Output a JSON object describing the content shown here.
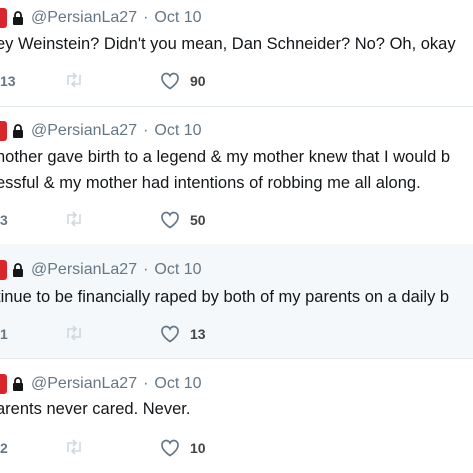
{
  "tweets": [
    {
      "handle": "@PersianLa27",
      "sep": "·",
      "date": "Oct 10",
      "lines": [
        "ey Weinstein? Didn't you mean, Dan Schneider? No? Oh, okay"
      ],
      "replies": "13",
      "likes": "90"
    },
    {
      "handle": "@PersianLa27",
      "sep": "·",
      "date": "Oct 10",
      "lines": [
        "nother gave birth to a legend & my mother knew that I would b",
        "essful & my mother had intentions of robbing me all along."
      ],
      "replies": "3",
      "likes": "50"
    },
    {
      "handle": "@PersianLa27",
      "sep": "·",
      "date": "Oct 10",
      "lines": [
        "tinue to be financially raped by both of my parents on a daily b"
      ],
      "replies": "1",
      "likes": "13"
    },
    {
      "handle": "@PersianLa27",
      "sep": "·",
      "date": "Oct 10",
      "lines": [
        "arents never cared. Never."
      ],
      "replies": "2",
      "likes": "10"
    }
  ],
  "colors": {
    "accent_red": "#d9252c",
    "muted": "#657786",
    "divider": "#e1e8ed",
    "shaded_bg": "#f5f8fa"
  },
  "icons": [
    "lock-icon",
    "retweet-icon",
    "heart-icon"
  ]
}
